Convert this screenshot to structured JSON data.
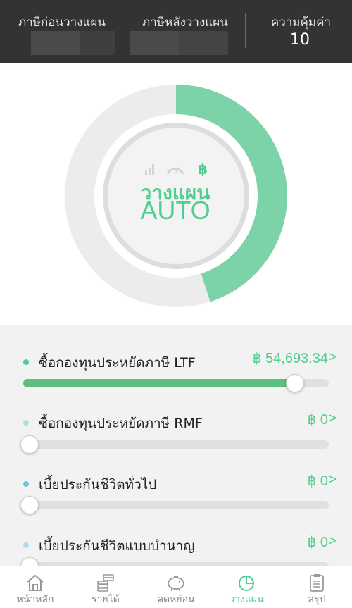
{
  "header": {
    "tax_before_label": "ภาษีก่อนวางแผน",
    "tax_after_label": "ภาษีหลังวางแผน",
    "value_label": "ความคุ้มค่า",
    "value_number": "10"
  },
  "center": {
    "icons": [
      "signal-bars-icon",
      "speedometer-icon",
      "baht-icon"
    ],
    "title": "วางแผน",
    "subtitle": "AUTO",
    "baht_symbol": "฿"
  },
  "donut": {
    "filled_fraction": 0.45,
    "accent_color": "#7dd3a8",
    "track_color": "#ececec"
  },
  "items": [
    {
      "label": "ซื้อกองทุนประหยัดภาษี LTF",
      "amount": "฿ 54,693.34",
      "chevron": ">",
      "dot_color": "#4fcf8e",
      "fill_fraction": 0.89
    },
    {
      "label": "ซื้อกองทุนประหยัดภาษี RMF",
      "amount": "฿ 0",
      "chevron": ">",
      "dot_color": "#a8e6be",
      "fill_fraction": 0
    },
    {
      "label": "เบี้ยประกันชีวิตทั่วไป",
      "amount": "฿ 0",
      "chevron": ">",
      "dot_color": "#6cc7e0",
      "fill_fraction": 0
    },
    {
      "label": "เบี้ยประกันชีวิตแบบบำนาญ",
      "amount": "฿ 0",
      "chevron": ">",
      "dot_color": "#a9def0",
      "fill_fraction": 0
    }
  ],
  "nav": [
    {
      "label": "หน้าหลัก",
      "icon": "home-icon",
      "active": false
    },
    {
      "label": "รายได้",
      "icon": "coins-icon",
      "active": false
    },
    {
      "label": "ลดหย่อน",
      "icon": "piggy-bank-icon",
      "active": false
    },
    {
      "label": "วางแผน",
      "icon": "pie-chart-icon",
      "active": true
    },
    {
      "label": "สรุป",
      "icon": "clipboard-icon",
      "active": false
    }
  ]
}
